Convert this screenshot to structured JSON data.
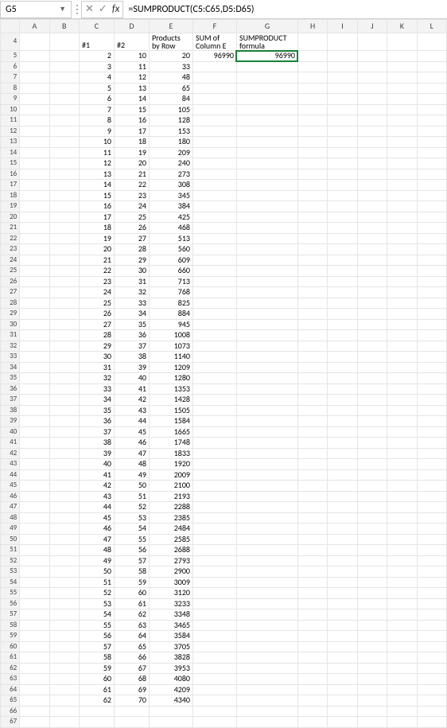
{
  "name_box": "G5",
  "formula": "=SUMPRODUCT(C5:C65,D5:D65)",
  "col_headers": [
    "A",
    "B",
    "C",
    "D",
    "E",
    "F",
    "G",
    "H",
    "I",
    "J",
    "K",
    "L"
  ],
  "row4": {
    "c": "#1",
    "d": "#2",
    "e1": "Products",
    "e2": "by Row",
    "f1": "SUM of",
    "f2": "Column E",
    "g1": "SUMPRODUCT",
    "g2": "formula"
  },
  "first_row_idx": 4,
  "f5": 96990,
  "g5": 96990,
  "rows": [
    {
      "c": 2,
      "d": 10,
      "e": 20
    },
    {
      "c": 3,
      "d": 11,
      "e": 33
    },
    {
      "c": 4,
      "d": 12,
      "e": 48
    },
    {
      "c": 5,
      "d": 13,
      "e": 65
    },
    {
      "c": 6,
      "d": 14,
      "e": 84
    },
    {
      "c": 7,
      "d": 15,
      "e": 105
    },
    {
      "c": 8,
      "d": 16,
      "e": 128
    },
    {
      "c": 9,
      "d": 17,
      "e": 153
    },
    {
      "c": 10,
      "d": 18,
      "e": 180
    },
    {
      "c": 11,
      "d": 19,
      "e": 209
    },
    {
      "c": 12,
      "d": 20,
      "e": 240
    },
    {
      "c": 13,
      "d": 21,
      "e": 273
    },
    {
      "c": 14,
      "d": 22,
      "e": 308
    },
    {
      "c": 15,
      "d": 23,
      "e": 345
    },
    {
      "c": 16,
      "d": 24,
      "e": 384
    },
    {
      "c": 17,
      "d": 25,
      "e": 425
    },
    {
      "c": 18,
      "d": 26,
      "e": 468
    },
    {
      "c": 19,
      "d": 27,
      "e": 513
    },
    {
      "c": 20,
      "d": 28,
      "e": 560
    },
    {
      "c": 21,
      "d": 29,
      "e": 609
    },
    {
      "c": 22,
      "d": 30,
      "e": 660
    },
    {
      "c": 23,
      "d": 31,
      "e": 713
    },
    {
      "c": 24,
      "d": 32,
      "e": 768
    },
    {
      "c": 25,
      "d": 33,
      "e": 825
    },
    {
      "c": 26,
      "d": 34,
      "e": 884
    },
    {
      "c": 27,
      "d": 35,
      "e": 945
    },
    {
      "c": 28,
      "d": 36,
      "e": 1008
    },
    {
      "c": 29,
      "d": 37,
      "e": 1073
    },
    {
      "c": 30,
      "d": 38,
      "e": 1140
    },
    {
      "c": 31,
      "d": 39,
      "e": 1209
    },
    {
      "c": 32,
      "d": 40,
      "e": 1280
    },
    {
      "c": 33,
      "d": 41,
      "e": 1353
    },
    {
      "c": 34,
      "d": 42,
      "e": 1428
    },
    {
      "c": 35,
      "d": 43,
      "e": 1505
    },
    {
      "c": 36,
      "d": 44,
      "e": 1584
    },
    {
      "c": 37,
      "d": 45,
      "e": 1665
    },
    {
      "c": 38,
      "d": 46,
      "e": 1748
    },
    {
      "c": 39,
      "d": 47,
      "e": 1833
    },
    {
      "c": 40,
      "d": 48,
      "e": 1920
    },
    {
      "c": 41,
      "d": 49,
      "e": 2009
    },
    {
      "c": 42,
      "d": 50,
      "e": 2100
    },
    {
      "c": 43,
      "d": 51,
      "e": 2193
    },
    {
      "c": 44,
      "d": 52,
      "e": 2288
    },
    {
      "c": 45,
      "d": 53,
      "e": 2385
    },
    {
      "c": 46,
      "d": 54,
      "e": 2484
    },
    {
      "c": 47,
      "d": 55,
      "e": 2585
    },
    {
      "c": 48,
      "d": 56,
      "e": 2688
    },
    {
      "c": 49,
      "d": 57,
      "e": 2793
    },
    {
      "c": 50,
      "d": 58,
      "e": 2900
    },
    {
      "c": 51,
      "d": 59,
      "e": 3009
    },
    {
      "c": 52,
      "d": 60,
      "e": 3120
    },
    {
      "c": 53,
      "d": 61,
      "e": 3233
    },
    {
      "c": 54,
      "d": 62,
      "e": 3348
    },
    {
      "c": 55,
      "d": 63,
      "e": 3465
    },
    {
      "c": 56,
      "d": 64,
      "e": 3584
    },
    {
      "c": 57,
      "d": 65,
      "e": 3705
    },
    {
      "c": 58,
      "d": 66,
      "e": 3828
    },
    {
      "c": 59,
      "d": 67,
      "e": 3953
    },
    {
      "c": 60,
      "d": 68,
      "e": 4080
    },
    {
      "c": 61,
      "d": 69,
      "e": 4209
    },
    {
      "c": 62,
      "d": 70,
      "e": 4340
    }
  ],
  "trailing_empty_rows": [
    66,
    67
  ]
}
